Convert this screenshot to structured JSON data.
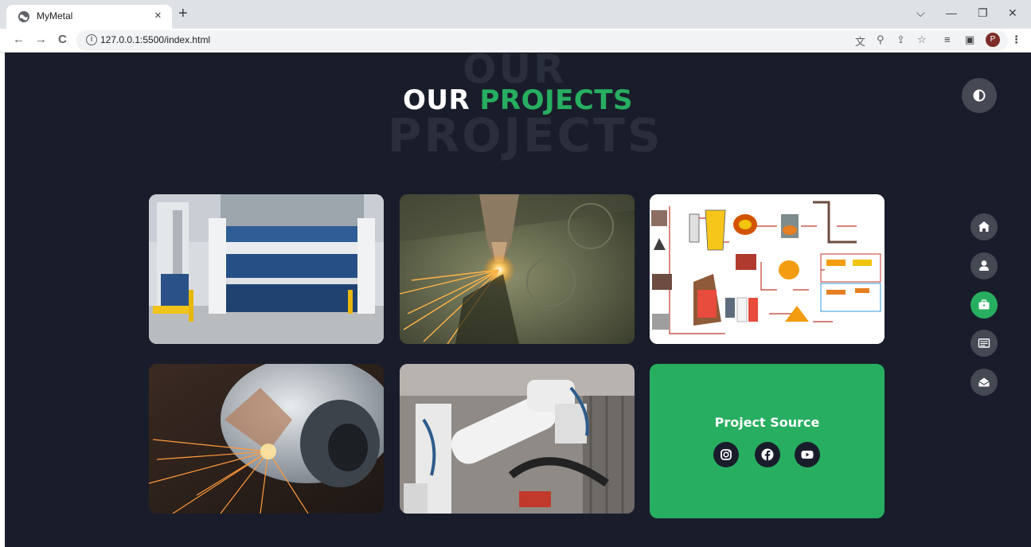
{
  "browser": {
    "tab_title": "MyMetal",
    "tab_close": "×",
    "new_tab": "+",
    "url": "127.0.0.1:5500/index.html",
    "profile_initial": "P",
    "window_controls": {
      "dropdown": "⌵",
      "minimize": "—",
      "restore": "❐",
      "close": "✕"
    },
    "nav": {
      "back": "←",
      "forward": "→",
      "reload": "C"
    },
    "icons": {
      "translate": "translate-icon",
      "zoom": "zoom-icon",
      "share": "share-icon",
      "bookmark": "star-icon",
      "reading_list": "reading-list-icon",
      "side_panel": "side-panel-icon",
      "menu": "kebab-menu-icon"
    }
  },
  "section": {
    "bg_word_top": "OUR",
    "bg_word_bottom": "PROJECTS",
    "title_white": "OUR",
    "title_green": "PROJECTS"
  },
  "projects": [
    {
      "image": "press-brake-machine"
    },
    {
      "image": "laser-cutting-sparks"
    },
    {
      "image": "steelmaking-process-diagram"
    },
    {
      "image": "grinding-wheel-sparks"
    },
    {
      "image": "industrial-robot-arm"
    }
  ],
  "source_card": {
    "title": "Project Source",
    "social": [
      "instagram-icon",
      "facebook-icon",
      "youtube-icon"
    ]
  },
  "side_nav": {
    "theme_toggle": "contrast-icon",
    "items": [
      "home-icon",
      "user-icon",
      "briefcase-icon",
      "newspaper-icon",
      "envelope-icon"
    ],
    "active_index": 2
  },
  "colors": {
    "accent": "#27ae60",
    "page_bg": "#191d2b",
    "button_bg": "#454954"
  }
}
